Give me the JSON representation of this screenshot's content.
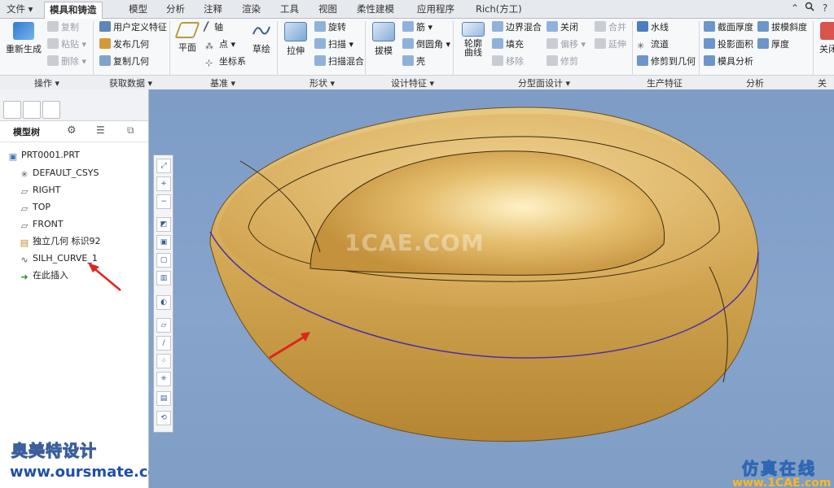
{
  "tabs": [
    "文件 ▾",
    "模具和铸造",
    "模型",
    "分析",
    "注释",
    "渲染",
    "工具",
    "视图",
    "柔性建模",
    "应用程序",
    "Rich(方工)"
  ],
  "active_tab_index": 1,
  "ribbon": {
    "regen": "重新生成",
    "copy": "复制",
    "paste": "粘贴 ▾",
    "delete": "删除 ▾",
    "udf": "用户定义特征",
    "publish_geom": "发布几何",
    "copy_geom": "复制几何",
    "plane": "平面",
    "axis": "轴",
    "point": "点 ▾",
    "csys": "坐标系",
    "sketch": "草绘",
    "extrude": "拉伸",
    "revolve": "旋转",
    "sweep": "扫描 ▾",
    "swept_blend": "扫描混合",
    "draft": "拔模",
    "rib": "筋 ▾",
    "round": "倒圆角 ▾",
    "shell": "壳",
    "silh_curve": "轮廓\n曲线",
    "boundary_blend": "边界混合",
    "fill": "填充",
    "remove": "移除",
    "close": "关闭",
    "offset": "偏移 ▾",
    "trim": "修剪",
    "merge": "合并",
    "extend": "延伸",
    "waterline": "水线",
    "flow": "流道",
    "trim_to_geom": "修剪到几何",
    "section_thickness": "截面厚度",
    "projected_area": "投影面积",
    "mold_analysis": "模具分析",
    "draft_slope": "拔模斜度",
    "thickness": "厚度",
    "close_right": "关闭"
  },
  "groups": [
    "操作 ▾",
    "获取数据 ▾",
    "基准 ▾",
    "形状 ▾",
    "设计特征 ▾",
    "分型面设计 ▾",
    "生产特征",
    "分析",
    "关闭"
  ],
  "panel": {
    "model_tree_label": "模型树",
    "tree": [
      "PRT0001.PRT",
      "DEFAULT_CSYS",
      "RIGHT",
      "TOP",
      "FRONT",
      "独立几何 标识92",
      "SILH_CURVE_1",
      "在此插入"
    ]
  },
  "watermarks": {
    "center": "1CAE.COM",
    "brand_cn": "奥美特设计",
    "brand_url": "www.oursmate.com",
    "site_cn": "仿真在线",
    "site_url": "www.1CAE.com"
  },
  "colors": {
    "part": "#d8b062",
    "background": "#7f9dc5",
    "arrow": "#e0241c"
  }
}
